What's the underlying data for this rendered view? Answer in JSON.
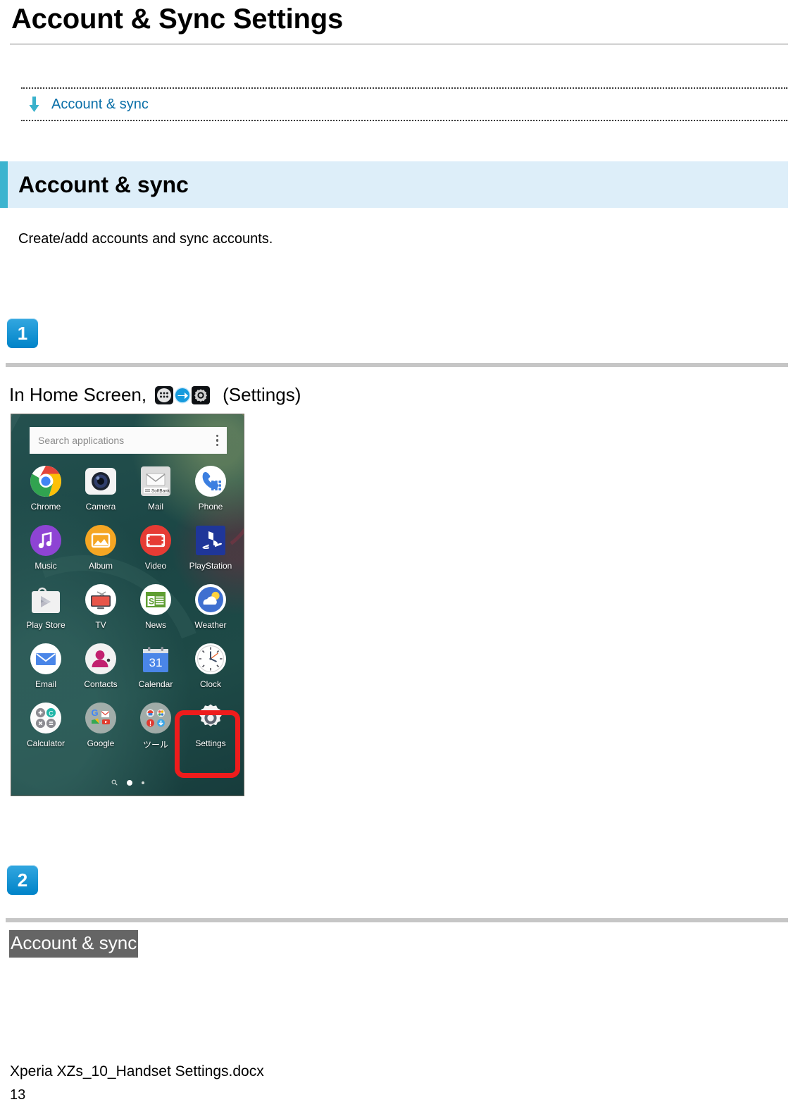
{
  "document": {
    "title": "Account & Sync Settings"
  },
  "breadcrumb": {
    "arrow_icon": "down-arrow-icon",
    "label": "Account & sync"
  },
  "section": {
    "heading": "Account & sync",
    "description": "Create/add accounts and sync accounts.",
    "accent_color": "#3cb4cf",
    "background_color": "#ddeef9"
  },
  "steps": [
    {
      "number": "1",
      "instruction_prefix": "In Home Screen,",
      "instruction_suffix": "(Settings)",
      "icons": [
        "app-drawer-icon",
        "arrow-right-icon",
        "gear-icon"
      ]
    },
    {
      "number": "2",
      "instruction": "Account & sync",
      "highlight_background": "#656565"
    }
  ],
  "phone_screenshot": {
    "search": {
      "placeholder": "Search applications",
      "overflow_icon": "kebab-menu-icon"
    },
    "apps": [
      {
        "label": "Chrome",
        "icon": "chrome-icon"
      },
      {
        "label": "Camera",
        "icon": "camera-icon"
      },
      {
        "label": "Mail",
        "icon": "mail-icon",
        "badge": "SoftBank"
      },
      {
        "label": "Phone",
        "icon": "phone-icon"
      },
      {
        "label": "Music",
        "icon": "music-icon"
      },
      {
        "label": "Album",
        "icon": "album-icon"
      },
      {
        "label": "Video",
        "icon": "video-icon"
      },
      {
        "label": "PlayStation",
        "icon": "playstation-icon"
      },
      {
        "label": "Play Store",
        "icon": "play-store-icon"
      },
      {
        "label": "TV",
        "icon": "tv-icon"
      },
      {
        "label": "News",
        "icon": "news-icon"
      },
      {
        "label": "Weather",
        "icon": "weather-icon"
      },
      {
        "label": "Email",
        "icon": "email-icon"
      },
      {
        "label": "Contacts",
        "icon": "contacts-icon"
      },
      {
        "label": "Calendar",
        "icon": "calendar-icon",
        "day": "31"
      },
      {
        "label": "Clock",
        "icon": "clock-icon"
      },
      {
        "label": "Calculator",
        "icon": "calculator-icon"
      },
      {
        "label": "Google",
        "icon": "google-folder-icon"
      },
      {
        "label": "ツール",
        "icon": "tools-folder-icon"
      },
      {
        "label": "Settings",
        "icon": "settings-gear-icon",
        "highlighted": true
      }
    ],
    "page_indicator": {
      "search_icon": "search-icon",
      "pages": 2,
      "active": 1
    },
    "highlight_color": "#ee1c1c"
  },
  "footer": {
    "file_name": "Xperia XZs_10_Handset Settings.docx",
    "page_number": "13"
  }
}
